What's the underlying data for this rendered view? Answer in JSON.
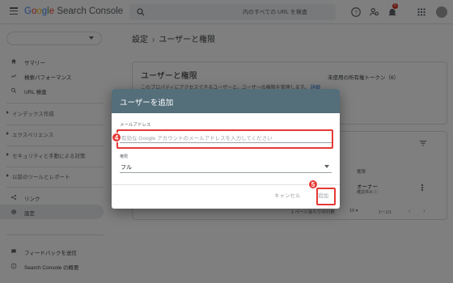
{
  "topbar": {
    "logo": {
      "g1": "G",
      "g2": "o",
      "g3": "o",
      "g4": "g",
      "g5": "l",
      "g6": "e",
      "rest": " Search Console"
    },
    "search_text": "内のすべての URL を検査",
    "notification_count": "5"
  },
  "sidebar": {
    "items": [
      {
        "label": "サマリー"
      },
      {
        "label": "検索パフォーマンス"
      },
      {
        "label": "URL 検査"
      }
    ],
    "sections": [
      {
        "label": "インデックス作成"
      },
      {
        "label": "エクスペリエンス"
      },
      {
        "label": "セキュリティと手動による対策"
      },
      {
        "label": "以前のツールとレポート"
      }
    ],
    "bottom_items": [
      {
        "label": "リンク"
      },
      {
        "label": "設定"
      }
    ],
    "footer_items": [
      {
        "label": "フィードバックを送信"
      },
      {
        "label": "Search Console の概要"
      }
    ]
  },
  "main": {
    "breadcrumb": {
      "parent": "設定",
      "separator": "›",
      "current": "ユーザーと権限"
    },
    "card1": {
      "title": "ユーザーと権限",
      "description": "このプロパティにアクセスできるユーザーと、ユーザーの権限を管理します。",
      "link": "詳細",
      "unused_token": "未使用の所有権トークン（6）"
    },
    "table": {
      "permission_header": "権限",
      "owner": "オーナー",
      "owner_sub": "確認済み ⓘ",
      "rows_per_page": "1 ページあたりの行数",
      "page_size": "10 ▾",
      "range": "1〜1/1",
      "prev": "‹",
      "next": "›"
    }
  },
  "dialog": {
    "title": "ユーザーを追加",
    "email_label": "メールアドレス",
    "email_placeholder": "有効な Google アカウントのメールアドレスを入力してください",
    "permission_label": "権限",
    "permission_value": "フル",
    "cancel_label": "キャンセル",
    "add_label": "追加"
  },
  "annotations": {
    "step4": "4",
    "step5": "5",
    "color": "#e53935"
  },
  "colors": {
    "dialog_header": "#546e7a",
    "link": "#1a73e8",
    "overlay": "rgba(0,0,0,0.5)"
  }
}
